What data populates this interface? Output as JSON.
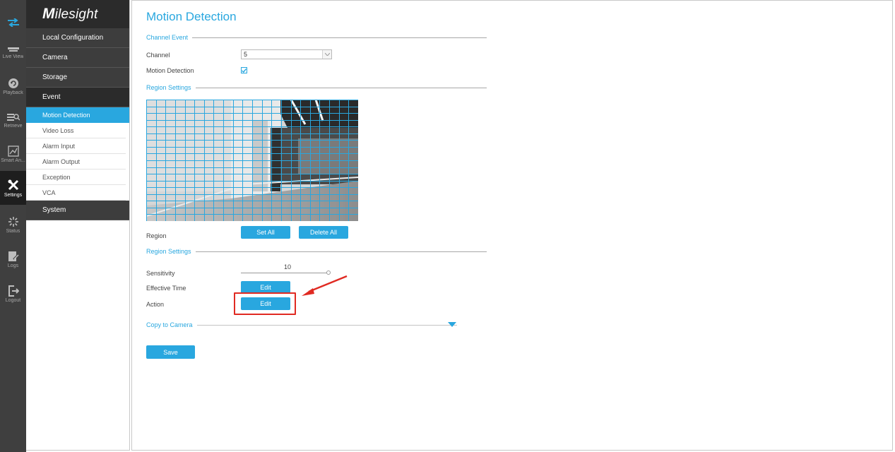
{
  "rail": {
    "items": [
      {
        "label": "Live View",
        "icon": "live-view-icon"
      },
      {
        "label": "Playback",
        "icon": "playback-icon"
      },
      {
        "label": "Retrieve",
        "icon": "retrieve-icon"
      },
      {
        "label": "Smart An...",
        "icon": "smart-analysis-icon"
      },
      {
        "label": "Settings",
        "icon": "settings-icon"
      },
      {
        "label": "Status",
        "icon": "status-icon"
      },
      {
        "label": "Logs",
        "icon": "logs-icon"
      },
      {
        "label": "Logout",
        "icon": "logout-icon"
      }
    ],
    "active": "Settings"
  },
  "menu": {
    "logo_first": "M",
    "logo_rest": "ilesight",
    "groups": {
      "local": "Local Configuration",
      "camera": "Camera",
      "storage": "Storage",
      "event": "Event",
      "system": "System"
    },
    "event_items": [
      "Motion Detection",
      "Video Loss",
      "Alarm Input",
      "Alarm Output",
      "Exception",
      "VCA"
    ]
  },
  "main": {
    "title": "Motion Detection",
    "channel_event": "Channel Event",
    "channel_label": "Channel",
    "channel_value": "5",
    "motion_detection_label": "Motion Detection",
    "motion_detection_checked": true,
    "region_settings_1": "Region Settings",
    "region_label": "Region",
    "set_all": "Set All",
    "delete_all": "Delete All",
    "region_settings_2": "Region Settings",
    "sensitivity_label": "Sensitivity",
    "sensitivity_value": "10",
    "effective_time_label": "Effective Time",
    "effective_time_button": "Edit",
    "action_label": "Action",
    "action_button": "Edit",
    "copy_to_camera": "Copy to Camera",
    "save": "Save"
  },
  "colors": {
    "accent": "#29a7df",
    "annotation": "#e02a22",
    "rail_bg": "#3f3f3f",
    "menu_dark": "#2b2b2b"
  }
}
